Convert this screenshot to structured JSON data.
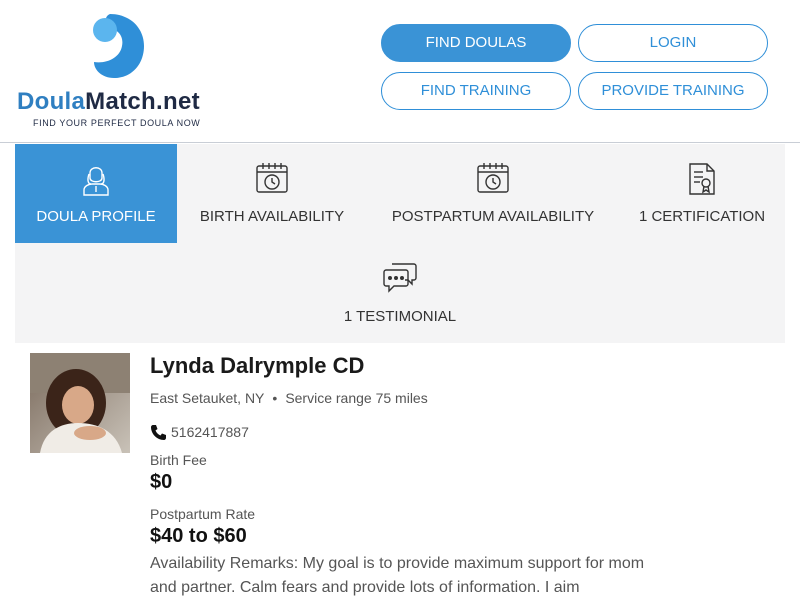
{
  "brand": {
    "name_part1": "Doula",
    "name_part2": "Match.net",
    "tagline": "FIND YOUR PERFECT DOULA NOW",
    "color_primary": "#3a93d6",
    "color_dark": "#1f2a44"
  },
  "nav": {
    "find_doulas": "FIND DOULAS",
    "login": "LOGIN",
    "find_training": "FIND TRAINING",
    "provide_training": "PROVIDE TRAINING"
  },
  "tabs": [
    {
      "label": "DOULA PROFILE",
      "icon": "doula-profile-icon",
      "active": true
    },
    {
      "label": "BIRTH AVAILABILITY",
      "icon": "calendar-clock-icon"
    },
    {
      "label": "POSTPARTUM AVAILABILITY",
      "icon": "calendar-clock-icon"
    },
    {
      "label": "1 CERTIFICATION",
      "icon": "certificate-icon"
    },
    {
      "label": "1 TESTIMONIAL",
      "icon": "chat-bubbles-icon"
    }
  ],
  "profile": {
    "name": "Lynda Dalrymple CD",
    "location": "East Setauket, NY",
    "service_range": "Service range 75 miles",
    "phone": "5162417887",
    "birth_fee_label": "Birth Fee",
    "birth_fee": "$0",
    "postpartum_label": "Postpartum Rate",
    "postpartum_rate": "$40 to $60",
    "remarks": "Availability Remarks: My goal is to provide maximum support for mom and partner. Calm fears and provide lots of information. I aim"
  }
}
